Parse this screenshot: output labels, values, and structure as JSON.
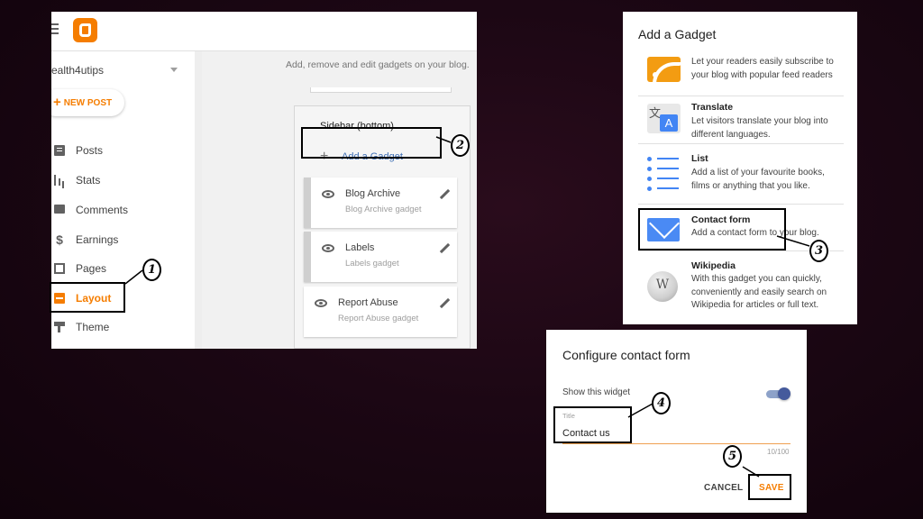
{
  "blogger": {
    "blog_name": "ealth4utips",
    "new_post_label": "NEW POST",
    "nav": [
      {
        "id": "posts",
        "label": "Posts",
        "icon": "posts-icon"
      },
      {
        "id": "stats",
        "label": "Stats",
        "icon": "stats-icon"
      },
      {
        "id": "comments",
        "label": "Comments",
        "icon": "comments-icon"
      },
      {
        "id": "earnings",
        "label": "Earnings",
        "icon": "dollar-icon"
      },
      {
        "id": "pages",
        "label": "Pages",
        "icon": "pages-icon"
      },
      {
        "id": "layout",
        "label": "Layout",
        "icon": "layout-icon",
        "active": true
      },
      {
        "id": "theme",
        "label": "Theme",
        "icon": "theme-icon"
      }
    ],
    "subtitle": "Add, remove and edit gadgets on your blog.",
    "section_title": "Sidebar (bottom)",
    "add_gadget_label": "Add a Gadget",
    "gadgets": [
      {
        "name": "Blog Archive",
        "sub": "Blog Archive gadget"
      },
      {
        "name": "Labels",
        "sub": "Labels gadget"
      },
      {
        "name": "Report Abuse",
        "sub": "Report Abuse gadget"
      }
    ]
  },
  "add_gadget_dialog": {
    "title": "Add a Gadget",
    "items": [
      {
        "title": "",
        "desc": "Let your readers easily subscribe to your blog with popular feed readers",
        "icon": "rss-icon"
      },
      {
        "title": "Translate",
        "desc": "Let visitors translate your blog into different languages.",
        "icon": "translate-icon"
      },
      {
        "title": "List",
        "desc": "Add a list of your favourite books, films or anything that you like.",
        "icon": "list-icon"
      },
      {
        "title": "Contact form",
        "desc": "Add a contact form to your blog.",
        "icon": "mail-icon"
      },
      {
        "title": "Wikipedia",
        "desc": "With this gadget you can quickly, conveniently and easily search on Wikipedia for articles or full text.",
        "icon": "wikipedia-icon"
      }
    ]
  },
  "configure_dialog": {
    "title": "Configure contact form",
    "show_widget_label": "Show this widget",
    "show_widget_on": true,
    "title_field_label": "Title",
    "title_field_value": "Contact us",
    "counter": "10/100",
    "cancel_label": "CANCEL",
    "save_label": "SAVE"
  },
  "steps": [
    "1",
    "2",
    "3",
    "4",
    "5"
  ],
  "colors": {
    "accent": "#f57d00",
    "link": "#3f6fb5",
    "mail": "#4a8af4",
    "background": "#1c0714"
  }
}
